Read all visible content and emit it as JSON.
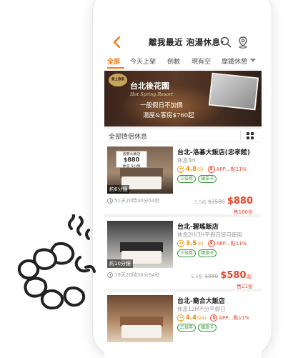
{
  "header": {
    "title": "離我最近 泡湯休息",
    "caret": "▾"
  },
  "tabs": [
    {
      "label": "全部",
      "active": true
    },
    {
      "label": "今天上架"
    },
    {
      "label": "倒數"
    },
    {
      "label": "現有空"
    },
    {
      "label": "摩鐵休憩"
    }
  ],
  "banner": {
    "badge": "愛上旅宿",
    "title": "台北後花園",
    "script": "Hot Spring Resort",
    "line1": "一般假日不加價",
    "line2": "湯屋&客房$760起"
  },
  "section": {
    "title": "全部情侶休息"
  },
  "listings": [
    {
      "name": "台北-洛碁大飯店(忠孝館)",
      "desc": "休息3H",
      "score": "4.8",
      "count": "(5)",
      "promo": "APP…點11%",
      "tags": [
        "三倍券",
        "國旅卡"
      ],
      "thumb_time": "約6分鐘",
      "thumb_sign_line1": "洛碁大飯店",
      "thumb_sign_price": "$880",
      "thumb_sign_line3": "休息 3小時",
      "countdown": "51天20時30分54秒",
      "discount": "5.5折",
      "original": "$1580",
      "price": "$880",
      "sold": "售180份"
    },
    {
      "name": "台北-碧瑤飯店",
      "desc": "休息2H/3H平假日皆可使用",
      "score": "3.5",
      "count": "(6)",
      "promo": "APP…點11%",
      "tags": [
        "三倍券",
        "國旅卡"
      ],
      "thumb_time": "約10分鐘",
      "countdown": "19天20時30分54秒",
      "discount": "6.6折",
      "original": "$880",
      "price": "$580",
      "price_suffix": "起",
      "sold": "售21份"
    },
    {
      "name": "台北-裔合大飯店",
      "desc": "休息12H不分平假日",
      "score": "4.4",
      "count": "(24)",
      "promo": "APP…點11%",
      "tags": [
        "三倍券",
        "國旅卡"
      ]
    }
  ]
}
